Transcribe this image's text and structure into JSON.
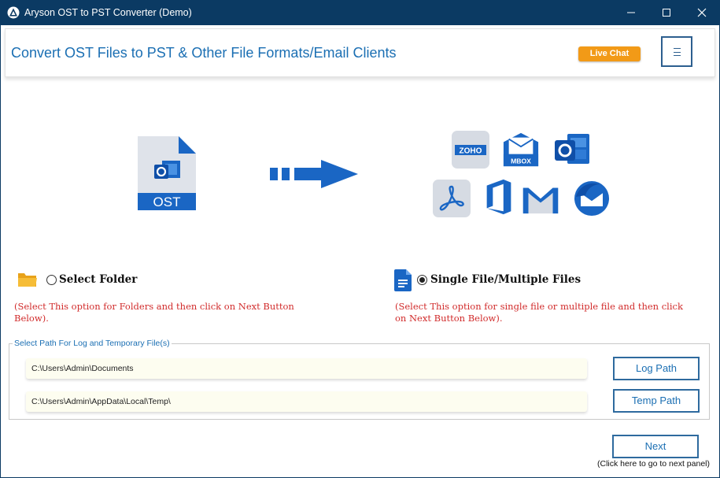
{
  "window": {
    "title": "Aryson OST to PST Converter (Demo)"
  },
  "header": {
    "heading": "Convert OST Files to PST & Other File Formats/Email Clients",
    "live_chat_label": "Live Chat"
  },
  "illustration": {
    "source_file_label": "OST",
    "target_icons": [
      "zoho-icon",
      "mbox-icon",
      "outlook-icon",
      "acrobat-pdf-icon",
      "office365-icon",
      "gmail-icon",
      "thunderbird-icon"
    ],
    "zoho_label": "ZOHO",
    "mbox_label": "MBOX"
  },
  "options": {
    "folder": {
      "label": "Select Folder",
      "selected": false,
      "hint": "(Select This option for Folders and then click on Next Button Below)."
    },
    "files": {
      "label": "Single File/Multiple Files",
      "selected": true,
      "hint": "(Select This option for single file or multiple file and then click on Next Button Below)."
    }
  },
  "paths": {
    "group_label": "Select Path For Log and Temporary File(s)",
    "log_path_value": "C:\\Users\\Admin\\Documents",
    "log_path_button": "Log Path",
    "temp_path_value": "C:\\Users\\Admin\\AppData\\Local\\Temp\\",
    "temp_path_button": "Temp Path"
  },
  "footer": {
    "next_label": "Next",
    "next_hint": "(Click here to go to next panel)"
  },
  "colors": {
    "titlebar": "#0b3a63",
    "accent_blue": "#1b6fb3",
    "live_chat": "#f29a17",
    "hint_red": "#d12b2b"
  }
}
